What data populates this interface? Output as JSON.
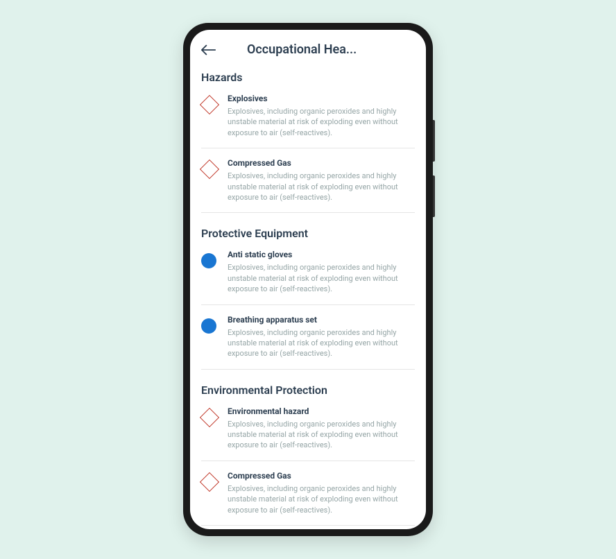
{
  "header": {
    "title": "Occupational Hea..."
  },
  "sections": [
    {
      "title": "Hazards",
      "items": [
        {
          "iconType": "diamond",
          "title": "Explosives",
          "desc": "Explosives, including organic peroxides and highly unstable material at risk of exploding even without exposure to air (self-reactives)."
        },
        {
          "iconType": "diamond",
          "title": "Compressed Gas",
          "desc": "Explosives, including organic peroxides and highly unstable material at risk of exploding even without exposure to air (self-reactives)."
        }
      ]
    },
    {
      "title": "Protective Equipment",
      "items": [
        {
          "iconType": "circle",
          "title": "Anti static gloves",
          "desc": "Explosives, including organic peroxides and highly unstable material at risk of exploding even without exposure to air (self-reactives)."
        },
        {
          "iconType": "circle",
          "title": "Breathing apparatus set",
          "desc": "Explosives, including organic peroxides and highly unstable material at risk of exploding even without exposure to air (self-reactives)."
        }
      ]
    },
    {
      "title": "Environmental Protection",
      "items": [
        {
          "iconType": "diamond",
          "title": "Environmental hazard",
          "desc": "Explosives, including organic peroxides and highly unstable material at risk of exploding even without exposure to air (self-reactives)."
        },
        {
          "iconType": "diamond",
          "title": "Compressed Gas",
          "desc": "Explosives, including organic peroxides and highly unstable material at risk of exploding even without exposure to air (self-reactives)."
        }
      ]
    }
  ]
}
